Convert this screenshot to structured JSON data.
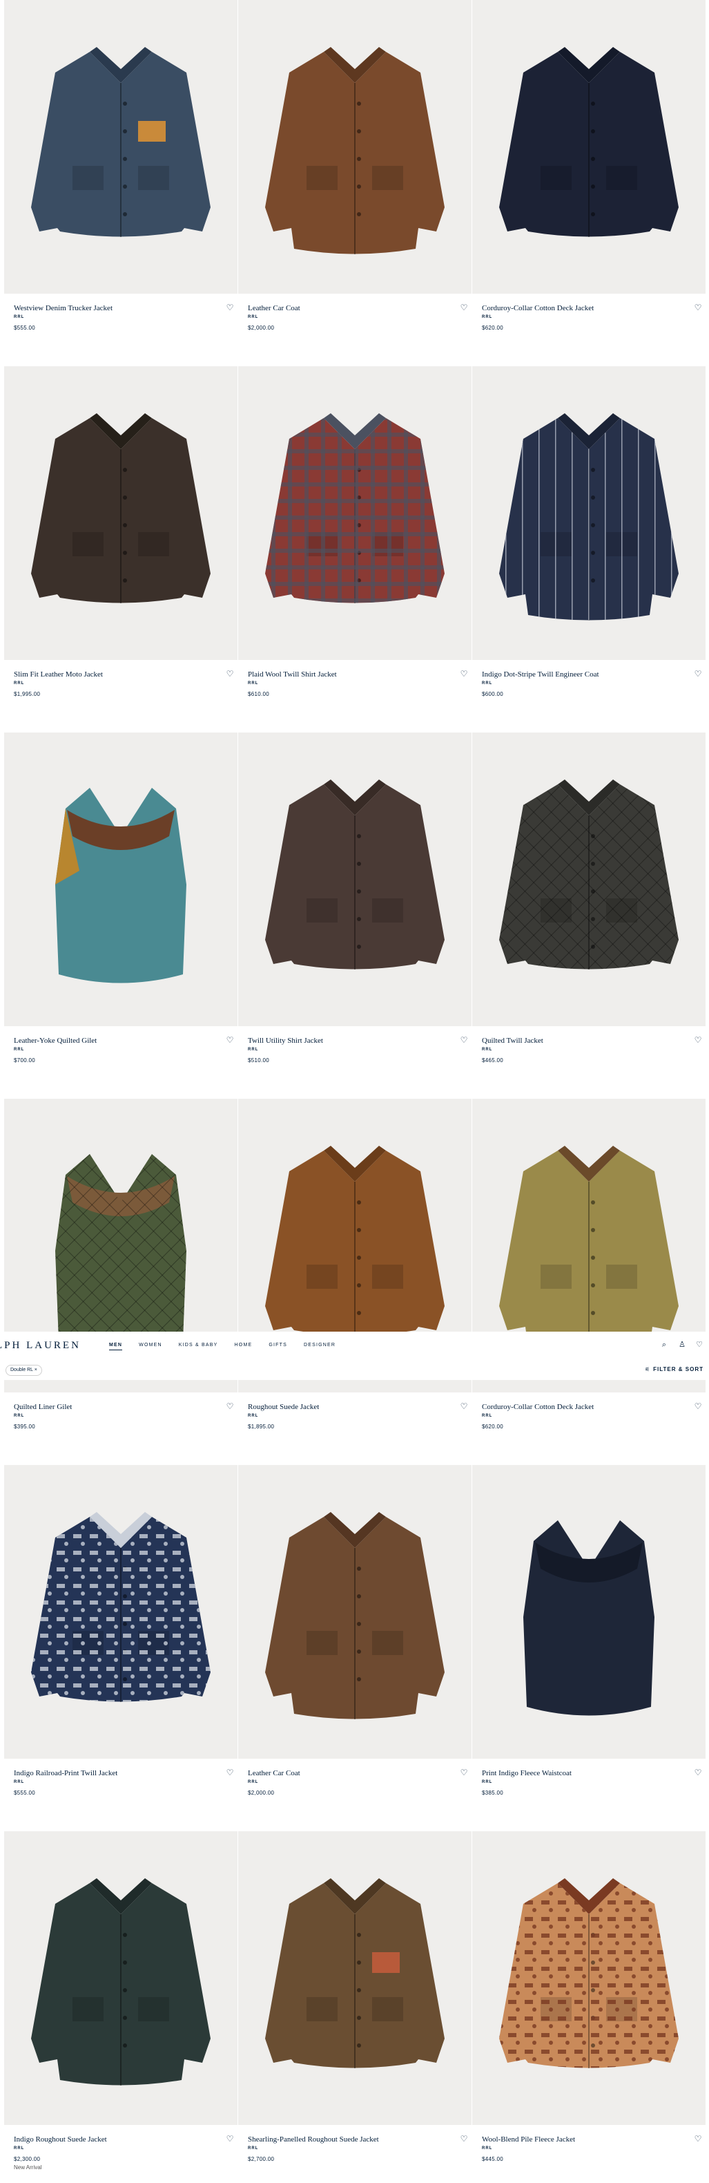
{
  "header": {
    "logo": "LPH LAUREN",
    "nav": [
      {
        "label": "MEN",
        "active": true
      },
      {
        "label": "WOMEN",
        "active": false
      },
      {
        "label": "KIDS & BABY",
        "active": false
      },
      {
        "label": "HOME",
        "active": false
      },
      {
        "label": "GIFTS",
        "active": false
      },
      {
        "label": "DESIGNER",
        "active": false
      }
    ],
    "icons": [
      "search-icon",
      "account-icon",
      "wishlist-icon"
    ]
  },
  "toolbar": {
    "chip_label": "Double RL ×",
    "filter_label": "FILTER & SORT",
    "filter_icon": "sliders-icon"
  },
  "products": [
    {
      "name": "Westview Denim Trucker Jacket",
      "brand": "RRL",
      "price": "$555.00",
      "tag": ""
    },
    {
      "name": "Leather Car Coat",
      "brand": "RRL",
      "price": "$2,000.00",
      "tag": ""
    },
    {
      "name": "Corduroy-Collar Cotton Deck Jacket",
      "brand": "RRL",
      "price": "$620.00",
      "tag": ""
    },
    {
      "name": "Slim Fit Leather Moto Jacket",
      "brand": "RRL",
      "price": "$1,995.00",
      "tag": ""
    },
    {
      "name": "Plaid Wool Twill Shirt Jacket",
      "brand": "RRL",
      "price": "$610.00",
      "tag": ""
    },
    {
      "name": "Indigo Dot-Stripe Twill Engineer Coat",
      "brand": "RRL",
      "price": "$600.00",
      "tag": ""
    },
    {
      "name": "Leather-Yoke Quilted Gilet",
      "brand": "RRL",
      "price": "$700.00",
      "tag": ""
    },
    {
      "name": "Twill Utility Shirt Jacket",
      "brand": "RRL",
      "price": "$510.00",
      "tag": ""
    },
    {
      "name": "Quilted Twill Jacket",
      "brand": "RRL",
      "price": "$465.00",
      "tag": ""
    },
    {
      "name": "Quilted Liner Gilet",
      "brand": "RRL",
      "price": "$395.00",
      "tag": ""
    },
    {
      "name": "Roughout Suede Jacket",
      "brand": "RRL",
      "price": "$1,895.00",
      "tag": ""
    },
    {
      "name": "Corduroy-Collar Cotton Deck Jacket",
      "brand": "RRL",
      "price": "$620.00",
      "tag": ""
    },
    {
      "name": "Indigo Railroad-Print Twill Jacket",
      "brand": "RRL",
      "price": "$555.00",
      "tag": ""
    },
    {
      "name": "Leather Car Coat",
      "brand": "RRL",
      "price": "$2,000.00",
      "tag": ""
    },
    {
      "name": "Print Indigo Fleece Waistcoat",
      "brand": "RRL",
      "price": "$385.00",
      "tag": ""
    },
    {
      "name": "Indigo Roughout Suede Jacket",
      "brand": "RRL",
      "price": "$2,300.00",
      "tag": "New Arrival"
    },
    {
      "name": "Shearling-Panelled Roughout Suede Jacket",
      "brand": "RRL",
      "price": "$2,700.00",
      "tag": ""
    },
    {
      "name": "Wool-Blend Pile Fleece Jacket",
      "brand": "RRL",
      "price": "$445.00",
      "tag": ""
    }
  ],
  "colors": {
    "navy": "#041e3a",
    "image_bg": "#efeeec"
  }
}
